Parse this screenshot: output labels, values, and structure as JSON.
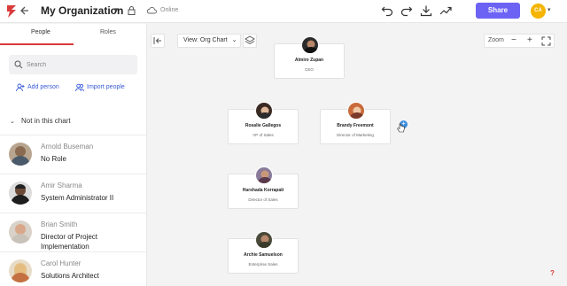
{
  "header": {
    "title": "My Organization",
    "status": "Online",
    "share_label": "Share",
    "user_initials": "CA",
    "brand_color": "#d93a3a",
    "accent_color": "#6c63f5"
  },
  "sidebar": {
    "tabs": [
      "People",
      "Roles"
    ],
    "search_placeholder": "Search",
    "add_person_label": "Add person",
    "import_people_label": "Import people",
    "section_title": "Not in this chart",
    "people": [
      {
        "name": "Arnold Buseman",
        "role": "No Role"
      },
      {
        "name": "Amir Sharma",
        "role": "System Administrator II"
      },
      {
        "name": "Brian Smith",
        "role": "Director of Project Implementation"
      },
      {
        "name": "Carol Hunter",
        "role": "Solutions Architect"
      }
    ]
  },
  "canvas": {
    "view_label": "View: Org Chart",
    "zoom_label": "Zoom",
    "zoom_out": "−",
    "zoom_in": "+",
    "help": "?",
    "nodes": [
      {
        "name": "Almiro Zupan",
        "title": "CEO"
      },
      {
        "name": "Rosalie Gallegos",
        "title": "VP of Sales"
      },
      {
        "name": "Brandy Freemont",
        "title": "Director of Marketing"
      },
      {
        "name": "Harshada Korrapati",
        "title": "Director of Sales"
      },
      {
        "name": "Archie Samuelson",
        "title": "Enterprise Sales"
      }
    ]
  }
}
